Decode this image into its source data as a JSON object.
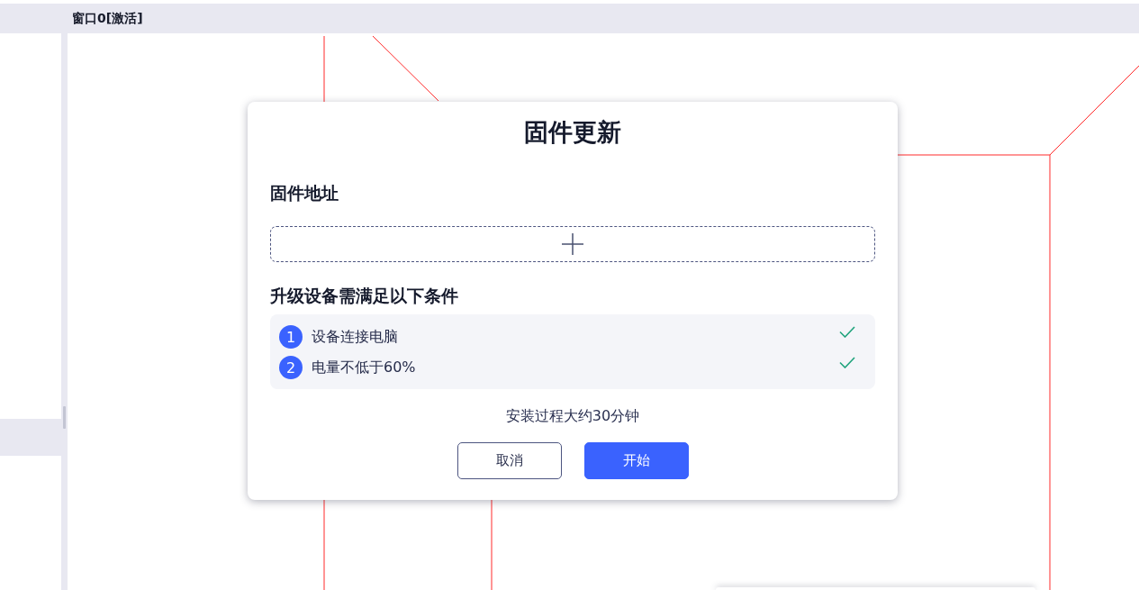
{
  "window": {
    "title": "窗口0[激活]"
  },
  "dialog": {
    "title": "固件更新",
    "firmware_section": {
      "label": "固件地址"
    },
    "conditions_section": {
      "label": "升级设备需满足以下条件",
      "conditions": [
        {
          "number": "1",
          "text": "设备连接电脑",
          "checked": true
        },
        {
          "number": "2",
          "text": "电量不低于60%",
          "checked": true
        }
      ]
    },
    "note": "安装过程大约30分钟",
    "buttons": [
      {
        "label": "取消",
        "kind": "secondary"
      },
      {
        "label": "开始",
        "kind": "primary"
      }
    ]
  }
}
